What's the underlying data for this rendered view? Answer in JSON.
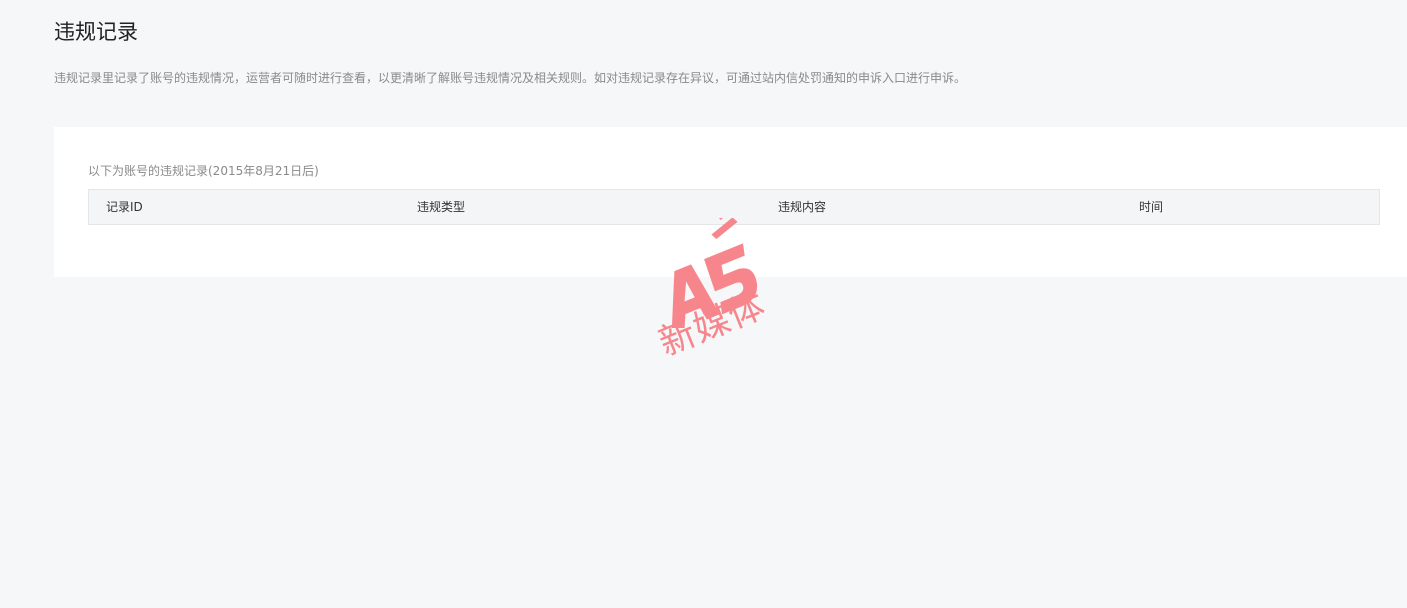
{
  "header": {
    "title": "违规记录",
    "description": "违规记录里记录了账号的违规情况，运营者可随时进行查看，以更清晰了解账号违规情况及相关规则。如对违规记录存在异议，可通过站内信处罚通知的申诉入口进行申诉。"
  },
  "records": {
    "caption": "以下为账号的违规记录(2015年8月21日后)",
    "columns": [
      "记录ID",
      "违规类型",
      "违规内容",
      "时间"
    ],
    "rows": []
  },
  "watermark": {
    "logo_text": "A5",
    "text": "新媒体",
    "color": "#f7868c"
  }
}
